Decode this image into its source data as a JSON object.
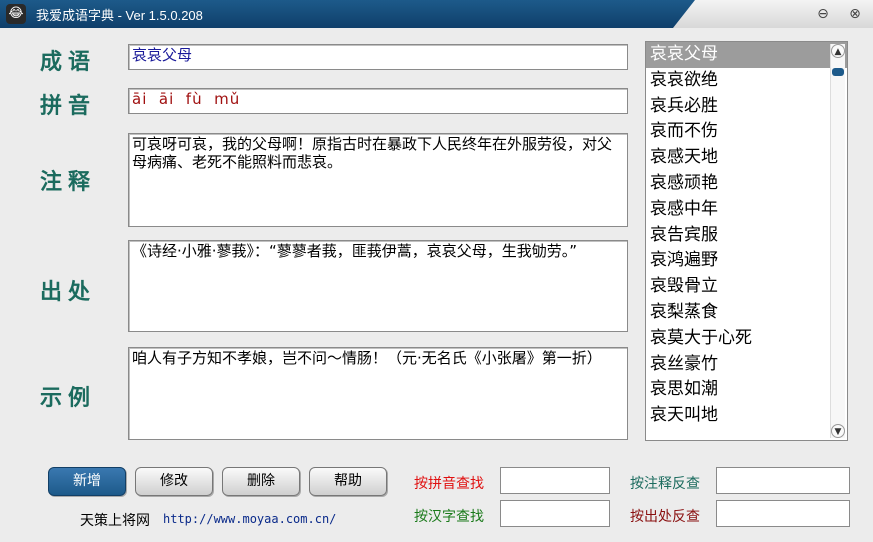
{
  "window": {
    "title": "我爱成语字典 - Ver 1.5.0.208",
    "app_icon": "😂",
    "minimize_glyph": "⊖",
    "close_glyph": "⊗"
  },
  "fields": {
    "idiom": {
      "label": "成语",
      "value": "哀哀父母"
    },
    "pinyin": {
      "label": "拼音",
      "value": "āi  āi  fù  mǔ"
    },
    "explanation": {
      "label": "注释",
      "value": "可哀呀可哀，我的父母啊！原指古时在暴政下人民终年在外服劳役，对父母病痛、老死不能照料而悲哀。"
    },
    "source": {
      "label": "出处",
      "value": "《诗经·小雅·蓼莪》：“蓼蓼者莪，匪莪伊蒿，哀哀父母，生我劬劳。”"
    },
    "example": {
      "label": "示例",
      "value": "咱人有子方知不孝娘，岂不问～情肠！（元·无名氏《小张屠》第一折）"
    }
  },
  "idiom_list": [
    "哀哀父母",
    "哀哀欲绝",
    "哀兵必胜",
    "哀而不伤",
    "哀感天地",
    "哀感顽艳",
    "哀感中年",
    "哀告宾服",
    "哀鸿遍野",
    "哀毁骨立",
    "哀梨蒸食",
    "哀莫大于心死",
    "哀丝豪竹",
    "哀思如潮",
    "哀天叫地"
  ],
  "selected_index": 0,
  "buttons": {
    "add": "新增",
    "edit": "修改",
    "delete": "删除",
    "help": "帮助"
  },
  "search": {
    "by_pinyin": "按拼音查找",
    "by_hanzi": "按汉字查找",
    "by_explanation": "按注释反查",
    "by_source": "按出处反查"
  },
  "footer": {
    "site_name": "天策上将网",
    "url": "http://www.moyaa.com.cn/"
  },
  "colors": {
    "label_teal": "#1b6b5e",
    "search_pinyin": "#e01010",
    "search_hanzi": "#1a7a1a",
    "search_explanation": "#1b6b5e",
    "search_source": "#8a1010"
  }
}
